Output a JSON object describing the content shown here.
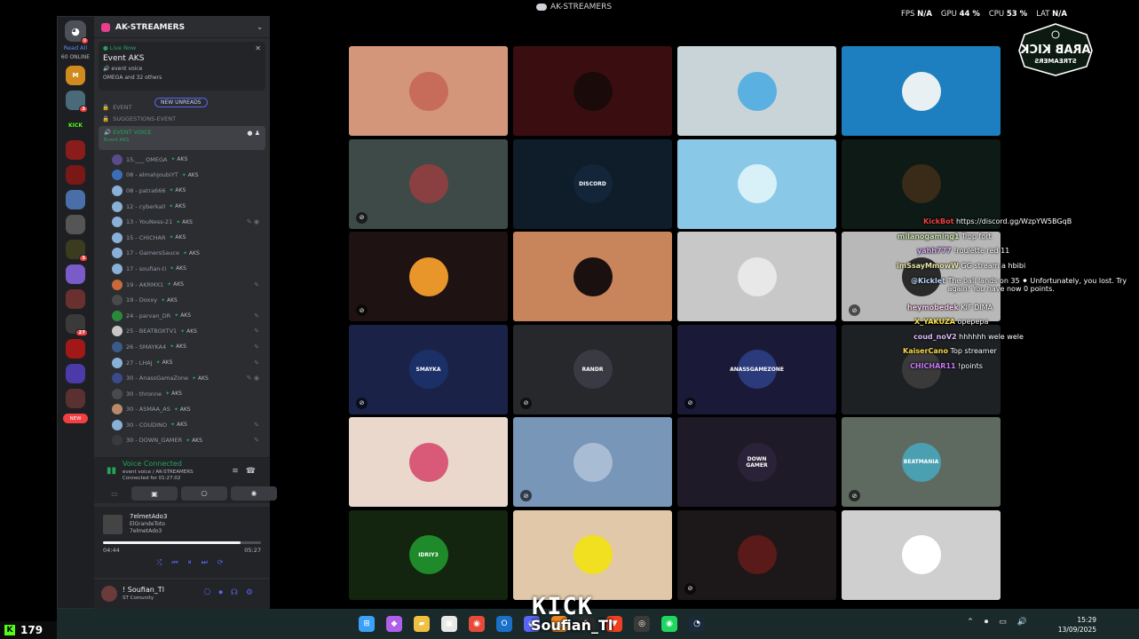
{
  "window_title": "AK-STREAMERS",
  "perf": {
    "fps_label": "FPS",
    "fps": "N/A",
    "gpu_label": "GPU",
    "gpu": "44 %",
    "cpu_label": "CPU",
    "cpu": "53 %",
    "lat_label": "LAT",
    "lat": "N/A"
  },
  "logo": {
    "line1": "ARAB KICK",
    "line2": "STREAMERS"
  },
  "guilds": {
    "home_badge": "9",
    "read_all": "Read All",
    "online": "60 ONLINE",
    "new_label": "NEW",
    "kick_label": "KICK",
    "icons": [
      {
        "text": "M",
        "color": "#d08a1e",
        "badge": ""
      },
      {
        "text": "",
        "color": "#4a6a7a",
        "badge": "3"
      },
      {
        "text": "KICK",
        "color": "#1e1f22",
        "badge": ""
      },
      {
        "text": "",
        "color": "#8a1c1c",
        "badge": ""
      },
      {
        "text": "",
        "color": "#7a1818",
        "badge": ""
      },
      {
        "text": "",
        "color": "#4a6fa8",
        "badge": ""
      },
      {
        "text": "",
        "color": "#555555",
        "badge": ""
      },
      {
        "text": "",
        "color": "#3b3b1f",
        "badge": "3"
      },
      {
        "text": "",
        "color": "#7a5cc8",
        "badge": ""
      },
      {
        "text": "",
        "color": "#6a3030",
        "badge": ""
      },
      {
        "text": "",
        "color": "#3a3a3a",
        "badge": "27"
      },
      {
        "text": "",
        "color": "#a01818",
        "badge": ""
      },
      {
        "text": "",
        "color": "#4b3aa8",
        "badge": ""
      },
      {
        "text": "",
        "color": "#5a3030",
        "badge": ""
      }
    ]
  },
  "server": {
    "name": "AK-STREAMERS"
  },
  "live": {
    "status": "Live Now",
    "title": "Event AKS",
    "channel": "event voice",
    "people": "OMEGA and 32 others"
  },
  "new_unreads": "NEW UNREADS",
  "channels": [
    "EVENT",
    "SUGGESTIONS-EVENT"
  ],
  "voice_channel": {
    "name": "EVENT VOICE",
    "sub": "Event AKS"
  },
  "members": [
    {
      "name": "15.___ OMEGA",
      "tag": "AKS",
      "color": "#5a4b8a",
      "icon": ""
    },
    {
      "name": "08 - elmahjoubiYT",
      "tag": "AKS",
      "color": "#3a6fb8",
      "icon": ""
    },
    {
      "name": "08 - patra666",
      "tag": "AKS",
      "color": "#8ab0d8",
      "icon": ""
    },
    {
      "name": "12 - cyberkall",
      "tag": "AKS",
      "color": "#8ab0d8",
      "icon": ""
    },
    {
      "name": "13 - YouNess-21",
      "tag": "AKS",
      "color": "#8ab0d8",
      "icon": "✎ ◉"
    },
    {
      "name": "15 - CHICHAR",
      "tag": "AKS",
      "color": "#8ab0d8",
      "icon": ""
    },
    {
      "name": "17 - GamersSauce",
      "tag": "AKS",
      "color": "#8ab0d8",
      "icon": ""
    },
    {
      "name": "17 - soufian-ti",
      "tag": "AKS",
      "color": "#8ab0d8",
      "icon": ""
    },
    {
      "name": "19 - AKRMX1",
      "tag": "AKS",
      "color": "#c86a3a",
      "icon": "✎"
    },
    {
      "name": "19 - Doxxy",
      "tag": "AKS",
      "color": "#4a4a4a",
      "icon": ""
    },
    {
      "name": "24 - parvan_DR",
      "tag": "AKS",
      "color": "#2a8a3a",
      "icon": "✎"
    },
    {
      "name": "25 - BEATBOXTV1",
      "tag": "AKS",
      "color": "#c8c8c8",
      "icon": "✎"
    },
    {
      "name": "26 - SMAYKA4",
      "tag": "AKS",
      "color": "#3a5a8a",
      "icon": "✎"
    },
    {
      "name": "27 - LHAJ",
      "tag": "AKS",
      "color": "#8ab0d8",
      "icon": "✎"
    },
    {
      "name": "30 - AnassGamaZone",
      "tag": "AKS",
      "color": "#3a4a8a",
      "icon": "✎ ◉"
    },
    {
      "name": "30 - thronne",
      "tag": "AKS",
      "color": "#4a4a4a",
      "icon": ""
    },
    {
      "name": "30 - ASMAA_AS",
      "tag": "AKS",
      "color": "#b88a6a",
      "icon": ""
    },
    {
      "name": "30 - COUDINO",
      "tag": "AKS",
      "color": "#8ab0d8",
      "icon": "✎"
    },
    {
      "name": "30 - DOWN_GAMER",
      "tag": "AKS",
      "color": "#3a3a3a",
      "icon": "✎"
    }
  ],
  "voice": {
    "status": "Voice Connected",
    "path": "event voice / AK-STREAMERS",
    "time": "Connected for 01:27:02"
  },
  "music": {
    "title": "7elmetAdo3",
    "artist": "ElGrandeToto",
    "album": "7elmetAdo3",
    "current": "04:44",
    "total": "05:27",
    "progress": 0.87
  },
  "user": {
    "name": "! Soufian_Tl",
    "sub": "ST Comunity"
  },
  "tiles": [
    {
      "bg": "#d4967a",
      "av": "#c76b5a",
      "label": "",
      "mute": false
    },
    {
      "bg": "#3a0e10",
      "av": "#1a0a0a",
      "label": "",
      "mute": false
    },
    {
      "bg": "#c8d4d8",
      "av": "#5ab0e0",
      "label": "",
      "mute": false
    },
    {
      "bg": "#1d7fbf",
      "av": "#e8f0f4",
      "label": "",
      "mute": false
    },
    {
      "bg": "#3d4a47",
      "av": "#8a4040",
      "label": "",
      "mute": true
    },
    {
      "bg": "#0f1c2a",
      "av": "#132538",
      "label": "DISCORD",
      "mute": false
    },
    {
      "bg": "#8ac8e8",
      "av": "#d8f0f8",
      "label": "",
      "mute": false
    },
    {
      "bg": "#0d1a16",
      "av": "#3a2a18",
      "label": "",
      "mute": false
    },
    {
      "bg": "#1e1212",
      "av": "#e8962a",
      "label": "",
      "mute": true
    },
    {
      "bg": "#c8845a",
      "av": "#1a1010",
      "label": "",
      "mute": false
    },
    {
      "bg": "#c8c8c8",
      "av": "#e8e8e8",
      "label": "",
      "mute": false
    },
    {
      "bg": "#b8b8b8",
      "av": "#2a2a2a",
      "label": "",
      "mute": true
    },
    {
      "bg": "#1a2347",
      "av": "#1c3068",
      "label": "SMAYKA",
      "mute": true
    },
    {
      "bg": "#26282b",
      "av": "#3a3a44",
      "label": "RANDR",
      "mute": true
    },
    {
      "bg": "#1a1a38",
      "av": "#2a3a7a",
      "label": "ANASSGAMEZONE",
      "mute": true
    },
    {
      "bg": "#1e2124",
      "av": "#3a3a3a",
      "label": "",
      "mute": false
    },
    {
      "bg": "#ead8cc",
      "av": "#d85a78",
      "label": "",
      "mute": false
    },
    {
      "bg": "#7896b8",
      "av": "#a8bcd4",
      "label": "",
      "mute": true
    },
    {
      "bg": "#1f1a27",
      "av": "#2a2238",
      "label": "DOWN GAMER",
      "mute": false
    },
    {
      "bg": "#5e6a60",
      "av": "#4aa0b0",
      "label": "BEATMANIA",
      "mute": true
    },
    {
      "bg": "#13240f",
      "av": "#1e8a2a",
      "label": "IDRIY3",
      "mute": false
    },
    {
      "bg": "#e0c8a8",
      "av": "#f0e020",
      "label": "",
      "mute": false
    },
    {
      "bg": "#1c1718",
      "av": "#5a1a1a",
      "label": "",
      "mute": true
    },
    {
      "bg": "#cfcfcf",
      "av": "#ffffff",
      "label": "",
      "mute": false
    }
  ],
  "chat": [
    {
      "user": "KickBot",
      "color": "#f23f43",
      "text": "https://discord.gg/WzpYW5BGqB"
    },
    {
      "user": "milanogaming1",
      "color": "#c8e8a8",
      "text": "Trop fort"
    },
    {
      "user": "yahh777",
      "color": "#d8a8f8",
      "text": "!roulette red 11"
    },
    {
      "user": "imSsayMmowW",
      "color": "#e8e8a8",
      "text": "GG stream a hbibi"
    },
    {
      "user": "@Kicklet",
      "color": "#b8d8f8",
      "text": "The ball lands on 35 ⚫ Unfortunately, you lost. Try again! You have now 0 points."
    },
    {
      "user": "heymobedek",
      "color": "#f8c8e8",
      "text": "KIF DIMA"
    },
    {
      "user": "X_YAKUZA",
      "color": "#f8e048",
      "text": "opepepa"
    },
    {
      "user": "coud_noV2",
      "color": "#d8b8f8",
      "text": "hhhhhh wele wele"
    },
    {
      "user": "KaiserCano",
      "color": "#f8d848",
      "text": "Top streamer"
    },
    {
      "user": "CHICHAR11",
      "color": "#c878f8",
      "text": "!points"
    }
  ],
  "kick": {
    "letter": "K",
    "viewers": "179",
    "watermark": "KICK",
    "streamer": "Soufian_Tl"
  },
  "clock": {
    "time": "15:29",
    "date": "13/09/2025"
  },
  "taskbar_icons": [
    {
      "name": "windows-start-icon",
      "glyph": "⊞",
      "color": "#3aa0f8"
    },
    {
      "name": "copilot-icon",
      "glyph": "◆",
      "color": "#b060e8"
    },
    {
      "name": "folder-icon",
      "glyph": "▰",
      "color": "#f0c040"
    },
    {
      "name": "store-icon",
      "glyph": "▣",
      "color": "#e8e8e8"
    },
    {
      "name": "chrome-icon",
      "glyph": "◉",
      "color": "#e84a3a"
    },
    {
      "name": "outlook-icon",
      "glyph": "O",
      "color": "#1a70c8"
    },
    {
      "name": "discord-icon",
      "glyph": "◕",
      "color": "#5865f2"
    },
    {
      "name": "vlc-icon",
      "glyph": "▲",
      "color": "#f08820"
    },
    {
      "name": "app-icon",
      "glyph": "✎",
      "color": "#2a2a2a"
    },
    {
      "name": "brave-icon",
      "glyph": "▼",
      "color": "#f04020"
    },
    {
      "name": "obs-icon",
      "glyph": "◎",
      "color": "#3a3a3a"
    },
    {
      "name": "spotify-icon",
      "glyph": "◉",
      "color": "#1ed760"
    },
    {
      "name": "steam-icon",
      "glyph": "◔",
      "color": "#1a2a3a"
    }
  ]
}
